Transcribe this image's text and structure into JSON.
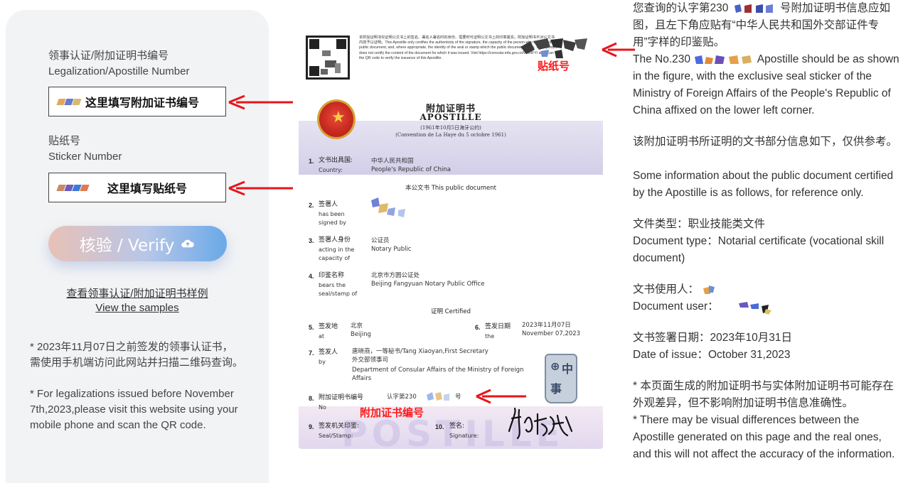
{
  "form": {
    "legalization_label_cn": "领事认证/附加证明书编号",
    "legalization_label_en": "Legalization/Apostille Number",
    "legalization_hint": "这里填写附加证书编号",
    "sticker_label_cn": "贴纸号",
    "sticker_label_en": "Sticker Number",
    "sticker_hint": "这里填写贴纸号",
    "verify_button": "核验 / Verify",
    "samples_cn": "查看领事认证/附加证明书样例",
    "samples_en": "View the samples",
    "note_cn": "* 2023年11月07日之前签发的领事认证书，需使用手机端访问此网站并扫描二维码查询。",
    "note_en": "* For legalizations issued before November 7th,2023,please visit this website using your mobile phone and scan the QR code."
  },
  "document": {
    "top_text": "本附加证明书仅证明公文书上的签名、署名人署名时的身份、需要时可证明公文书上的印章属实。附加证明书不对公文书内容予以证明。This Apostille only certifies the authenticity of the signature, the capacity of the person who has signed the public document, and, where appropriate, the identity of the seal or stamp which the public document bears. This Apostille does not certify the content of the document for which it was issued. Visit https://consular.mfa.gov.cn/VERIFY/ and scan the QR code to verify the issuance of this Apostille.",
    "sticker_label": "贴纸号",
    "title_cn": "附加证明书",
    "title_en": "APOSTILLE",
    "convention_cn": "(1961年10月5日海牙公约)",
    "convention_fr": "(Convention de La Haye du 5 octobre 1961)",
    "items": {
      "i1_num": "1.",
      "i1_cn": "文书出具国:",
      "i1_en": "Country:",
      "i1_val_cn": "中华人民共和国",
      "i1_val_en": "People's Republic of China",
      "public_doc": "本公文书 This public document",
      "i2_num": "2.",
      "i2_cn": "签署人",
      "i2_en1": "has been",
      "i2_en2": "signed by",
      "i3_num": "3.",
      "i3_cn": "签署人身份",
      "i3_en1": "acting in the",
      "i3_en2": "capacity of",
      "i3_val_cn": "公证员",
      "i3_val_en": "Notary Public",
      "i4_num": "4.",
      "i4_cn": "印鉴名称",
      "i4_en1": "bears the",
      "i4_en2": "seal/stamp of",
      "i4_val_cn": "北京市方圆公证处",
      "i4_val_en": "Beijing Fangyuan Notary Public Office",
      "certified": "证明 Certified",
      "i5_num": "5.",
      "i5_cn": "签发地",
      "i5_en": "at",
      "i5_val_cn": "北京",
      "i5_val_en": "Beijing",
      "i6_num": "6.",
      "i6_cn": "签发日期",
      "i6_en": "the",
      "i6_val_cn": "2023年11月07日",
      "i6_val_en": "November 07,2023",
      "i7_num": "7.",
      "i7_cn": "签发人",
      "i7_en": "by",
      "i7_val1": "唐晓燕，一等秘书/Tang Xiaoyan,First Secretary",
      "i7_val2": "外交部领事司",
      "i7_val3": "Department of Consular Affairs of the Ministry of Foreign",
      "i7_val4": "Affairs",
      "i8_num": "8.",
      "i8_cn": "附加证明书编号",
      "i8_en": "No",
      "i8_val": "认字第230",
      "i8_suffix": "号",
      "i9_num": "9.",
      "i9_cn": "签发机关印鉴:",
      "i9_en": "Seal/Stamp:",
      "i10_num": "10.",
      "i10_cn": "签名:",
      "i10_en": "Signature:"
    },
    "cert_no_label": "附加证书编号",
    "watermark": "POSTILLE"
  },
  "info": {
    "p1_cn_a": "您查询的认字第230",
    "p1_cn_b": "号附加证明书信息应如图，且左下角应贴有“中华人民共和国外交部证件专用”字样的印鉴贴。",
    "p1_en_a": "The No.230",
    "p1_en_b": "Apostille should be as shown in the figure, with the exclusive seal sticker of the Ministry of Foreign Affairs of the People's Republic of China affixed on the lower left corner.",
    "p2_cn": "该附加证明书所证明的文书部分信息如下，仅供参考。",
    "p2_en": "Some information about the public document certified by the Apostille is as follows, for reference only.",
    "doc_type_cn": "文件类型：职业技能类文件",
    "doc_type_en": "Document type：Notarial certificate (vocational skill document)",
    "doc_user_cn": "文书使用人：",
    "doc_user_en": "Document user：",
    "date_cn": "文书签署日期：2023年10月31日",
    "date_en": "Date of issue：October 31,2023",
    "note_cn": "* 本页面生成的附加证明书与实体附加证明书可能存在外观差异，但不影响附加证明书信息准确性。",
    "note_en": "* There may be visual differences between the Apostille generated on this page and the real ones, and this will not affect the accuracy of the information."
  },
  "colors": {
    "arrow": "#e8141a",
    "label_red": "#ff1a1a",
    "panel": "#f2f3f5"
  }
}
